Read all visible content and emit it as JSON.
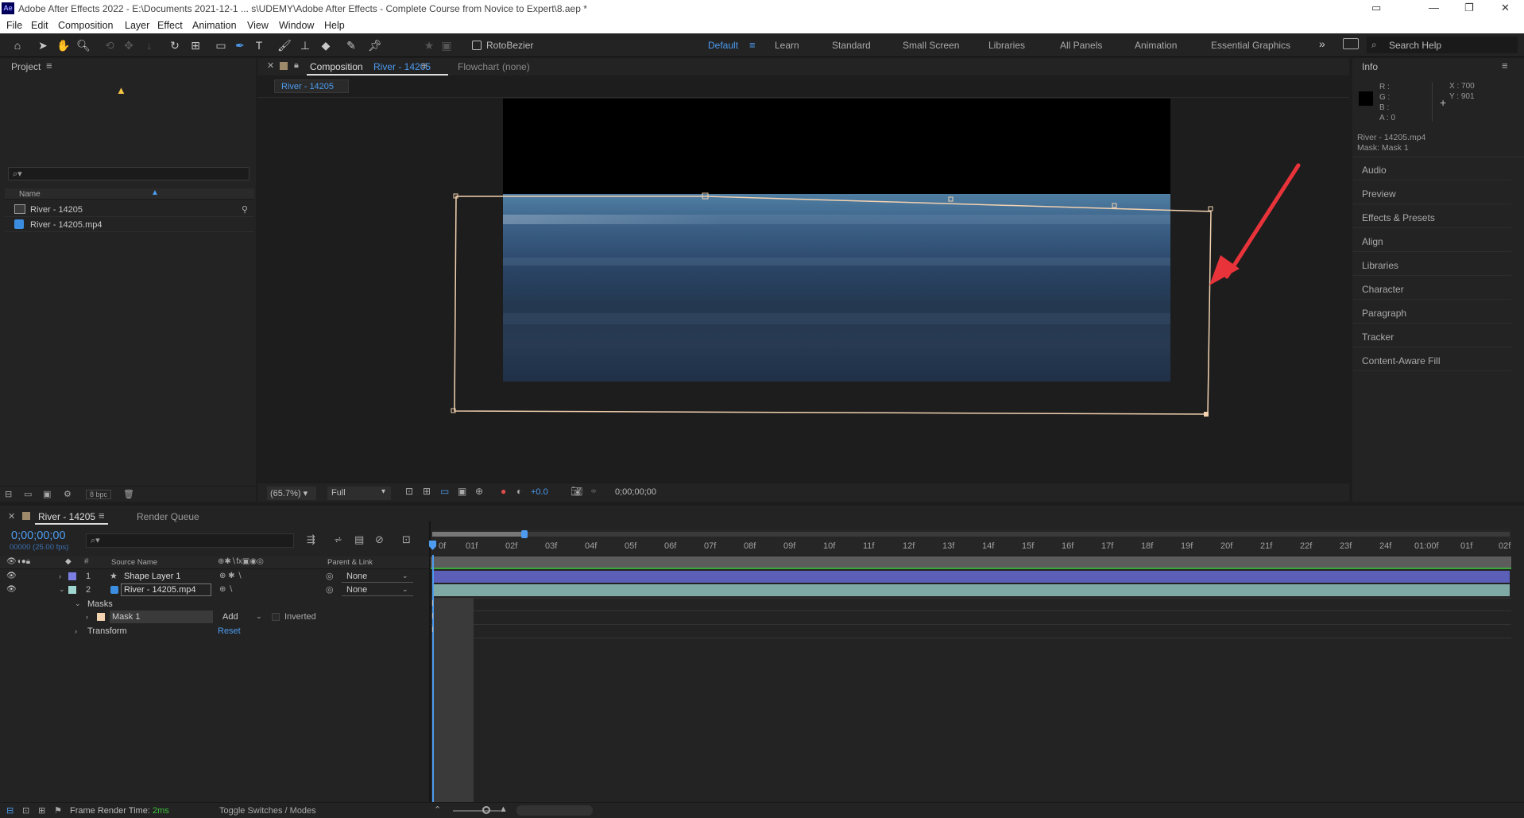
{
  "titlebar": {
    "app_icon": "Ae",
    "title": "Adobe After Effects 2022 - E:\\Documents 2021-12-1 ... s\\UDEMY\\Adobe After Effects - Complete Course from Novice to Expert\\8.aep *"
  },
  "menu": [
    "File",
    "Edit",
    "Composition",
    "Layer",
    "Effect",
    "Animation",
    "View",
    "Window",
    "Help"
  ],
  "toolbar": {
    "rotobezier_label": "RotoBezier",
    "workspaces": [
      "Default",
      "Learn",
      "Standard",
      "Small Screen",
      "Libraries",
      "All Panels",
      "Animation",
      "Essential Graphics"
    ],
    "active_workspace": "Default",
    "search_placeholder": "Search Help"
  },
  "project": {
    "title": "Project",
    "search_placeholder": "",
    "column_name": "Name",
    "items": [
      {
        "name": "River - 14205",
        "type": "composition"
      },
      {
        "name": "River - 14205.mp4",
        "type": "footage"
      }
    ],
    "bpc": "8 bpc"
  },
  "composition": {
    "tab_prefix": "Composition",
    "tab_name": "River - 14205",
    "flowchart": "Flowchart",
    "flowchart_value": "(none)",
    "subtab": "River - 14205",
    "zoom": "(65.7%)",
    "resolution": "Full",
    "exposure": "+0.0",
    "timecode": "0;00;00;00"
  },
  "info": {
    "title": "Info",
    "r": "R :",
    "g": "G :",
    "b": "B :",
    "a": "A :  0",
    "x": "X : 700",
    "y": "Y : 901",
    "layer_name": "River - 14205.mp4",
    "mask_line": "Mask: Mask 1"
  },
  "right_panels": [
    "Audio",
    "Preview",
    "Effects & Presets",
    "Align",
    "Libraries",
    "Character",
    "Paragraph",
    "Tracker",
    "Content-Aware Fill"
  ],
  "timeline": {
    "tab_name": "River - 14205",
    "render_queue": "Render Queue",
    "timecode": "0;00;00;00",
    "fps_line": "00000 (25.00 fps)",
    "col_source": "Source Name",
    "col_parent": "Parent & Link",
    "ruler": [
      "0f",
      "01f",
      "02f",
      "03f",
      "04f",
      "05f",
      "06f",
      "07f",
      "08f",
      "09f",
      "10f",
      "11f",
      "12f",
      "13f",
      "14f",
      "15f",
      "16f",
      "17f",
      "18f",
      "19f",
      "20f",
      "21f",
      "22f",
      "23f",
      "24f",
      "01:00f",
      "01f",
      "02f"
    ],
    "layers": [
      {
        "num": "1",
        "name": "Shape Layer 1",
        "parent": "None",
        "color": "#7b7fe4"
      },
      {
        "num": "2",
        "name": "River - 14205.mp4",
        "parent": "None",
        "color": "#9fd7d0"
      }
    ],
    "masks_label": "Masks",
    "mask_name": "Mask 1",
    "mask_mode": "Add",
    "inverted": "Inverted",
    "transform": "Transform",
    "reset": "Reset",
    "frame_render": "Frame Render Time:",
    "frame_render_value": "2ms",
    "toggle": "Toggle Switches / Modes"
  },
  "colors": {
    "accent": "#4d9cf0",
    "arrow": "#e8333a",
    "mask_path": "#f3d2b0"
  }
}
